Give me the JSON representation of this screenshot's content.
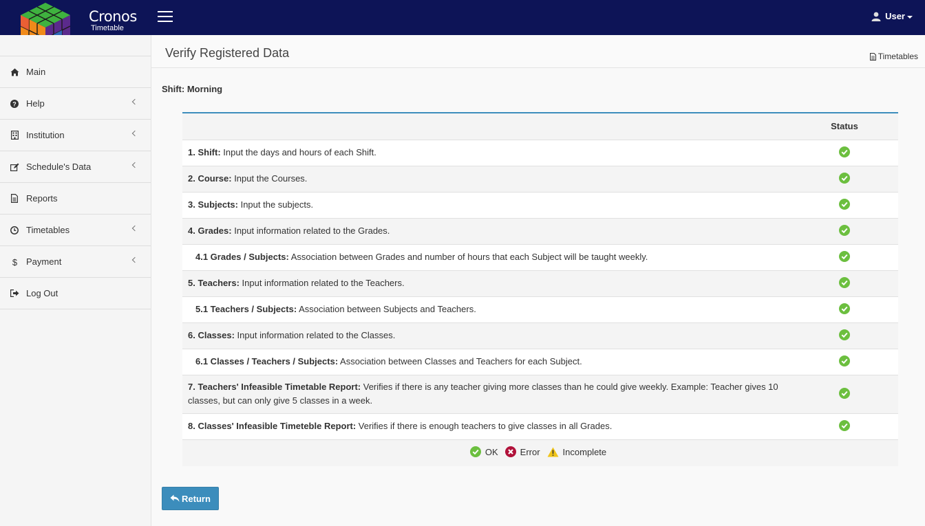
{
  "brand": {
    "name": "Cronos",
    "subtitle": "Timetable"
  },
  "user_menu": {
    "label": "User"
  },
  "sidebar": {
    "items": [
      {
        "label": "Main",
        "icon": "home-icon",
        "has_submenu": false
      },
      {
        "label": "Help",
        "icon": "question-circle-icon",
        "has_submenu": true
      },
      {
        "label": "Institution",
        "icon": "building-icon",
        "has_submenu": true
      },
      {
        "label": "Schedule's Data",
        "icon": "edit-icon",
        "has_submenu": true
      },
      {
        "label": "Reports",
        "icon": "file-text-icon",
        "has_submenu": false
      },
      {
        "label": "Timetables",
        "icon": "clock-icon",
        "has_submenu": true
      },
      {
        "label": "Payment",
        "icon": "dollar-icon",
        "has_submenu": true
      },
      {
        "label": "Log Out",
        "icon": "sign-out-icon",
        "has_submenu": false
      }
    ]
  },
  "page": {
    "title": "Verify Registered Data",
    "header_link": "Timetables",
    "shift": "Shift: Morning"
  },
  "table": {
    "status_header": "Status",
    "rows": [
      {
        "bold": "1. Shift:",
        "text": " Input the days and hours of each Shift.",
        "status": "ok"
      },
      {
        "bold": "2. Course:",
        "text": " Input the Courses.",
        "status": "ok"
      },
      {
        "bold": "3. Subjects:",
        "text": " Input the subjects.",
        "status": "ok"
      },
      {
        "bold": "4. Grades:",
        "text": " Input information related to the Grades.",
        "status": "ok"
      },
      {
        "bold": "4.1 Grades / Subjects:",
        "text": " Association between Grades and number of hours that each Subject will be taught weekly.",
        "status": "ok"
      },
      {
        "bold": "5. Teachers:",
        "text": " Input information related to the Teachers.",
        "status": "ok"
      },
      {
        "bold": "5.1 Teachers / Subjects:",
        "text": " Association between Subjects and Teachers.",
        "status": "ok"
      },
      {
        "bold": "6. Classes:",
        "text": " Input information related to the Classes.",
        "status": "ok"
      },
      {
        "bold": "6.1 Classes / Teachers / Subjects:",
        "text": " Association between Classes and Teachers for each Subject.",
        "status": "ok"
      },
      {
        "bold": "7. Teachers' Infeasible Timetable Report:",
        "text": " Verifies if there is any teacher giving more classes than he could give weekly. Example: Teacher gives 10 classes, but can only give 5 classes in a week.",
        "status": "ok"
      },
      {
        "bold": "8. Classes' Infeasible Timeteble Report:",
        "text": " Verifies if there is enough teachers to give classes in all Grades.",
        "status": "ok"
      }
    ],
    "legend": {
      "ok": "OK",
      "error": "Error",
      "incomplete": "Incomplete"
    }
  },
  "return_button": {
    "label": "Return"
  },
  "colors": {
    "topbar": "#0d1457",
    "accent": "#3c8dbc",
    "ok": "#6cbf3f",
    "error": "#b1123a",
    "warning": "#f0c419"
  }
}
